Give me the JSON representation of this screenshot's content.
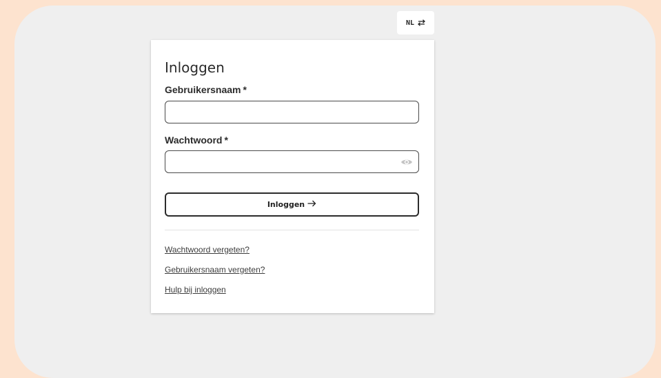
{
  "language": {
    "code": "NL",
    "switch_icon": "swap-arrows-icon"
  },
  "login": {
    "title": "Inloggen",
    "username": {
      "label": "Gebruikersnaam",
      "required_marker": "*",
      "value": ""
    },
    "password": {
      "label": "Wachtwoord",
      "required_marker": "*",
      "value": "",
      "toggle_icon": "eye-icon"
    },
    "submit": {
      "label": "Inloggen",
      "icon": "arrow-right-icon"
    },
    "links": {
      "forgot_password": "Wachtwoord vergeten?",
      "forgot_username": "Gebruikersnaam vergeten?",
      "help": "Hulp bij inloggen"
    }
  },
  "colors": {
    "outer_background": "#fde3cf",
    "frame_background": "#efefef",
    "card_background": "#ffffff",
    "text": "#2b2b2b"
  }
}
